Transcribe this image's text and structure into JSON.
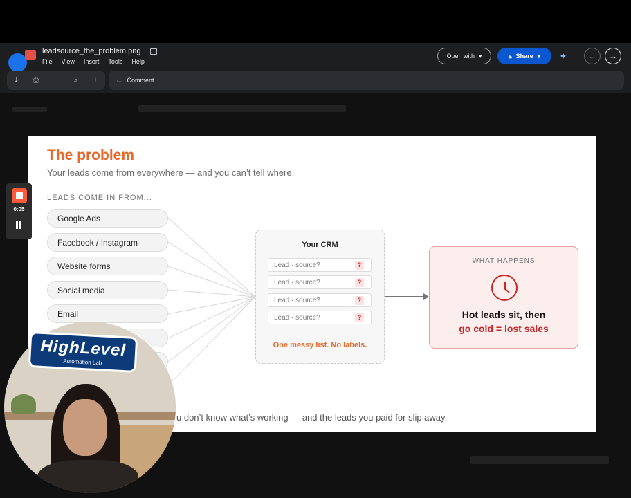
{
  "viewer": {
    "file_name": "leadsource_the_problem.png",
    "menu": [
      "File",
      "View",
      "Insert",
      "Tools",
      "Help"
    ],
    "open_with": "Open with",
    "share": "Share",
    "comment": "Comment"
  },
  "slide": {
    "title": "The problem",
    "subtitle": "Your leads come from everywhere — and you can’t tell where.",
    "section_label": "LEADS COME IN FROM...",
    "sources": [
      "Google Ads",
      "Facebook / Instagram",
      "Website forms",
      "Social media",
      "Email"
    ],
    "crm": {
      "title": "Your CRM",
      "rows": [
        "Lead · source?",
        "Lead · source?",
        "Lead · source?",
        "Lead · source?"
      ],
      "badge": "?",
      "footer": "One messy list. No labels."
    },
    "happens": {
      "label": "WHAT HAPPENS",
      "line1": "Hot leads sit, then",
      "line2": "go cold = lost sales"
    },
    "bottom_text": "u don’t know what’s working — and the leads you paid for slip away."
  },
  "recorder": {
    "time": "0:05"
  },
  "webcam": {
    "logo_text": "HighLevel",
    "logo_sub": "Automation Lab"
  },
  "colors": {
    "accent": "#e8682a",
    "danger": "#c62828",
    "share_blue": "#0b57d0"
  }
}
